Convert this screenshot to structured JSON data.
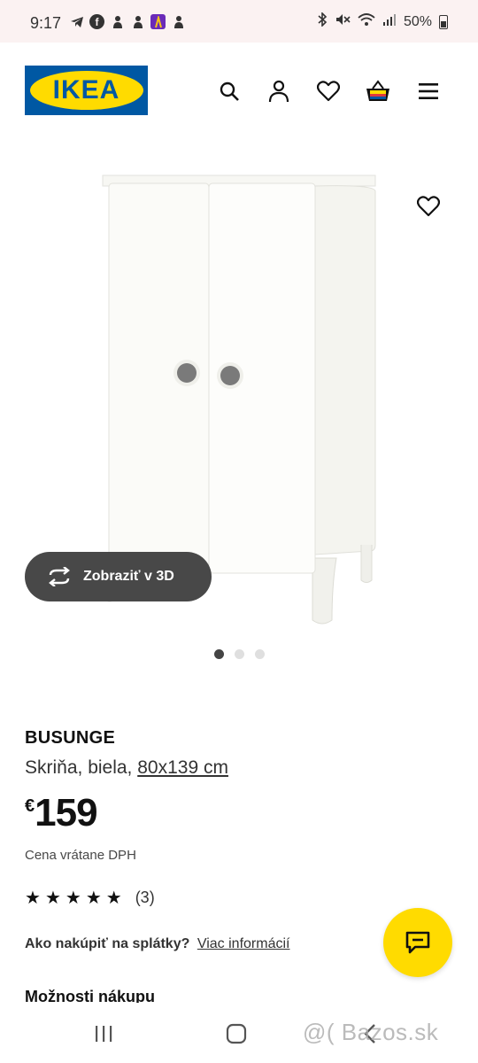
{
  "status_bar": {
    "time": "9:17",
    "battery": "50%",
    "left_icons": [
      "telegram-icon",
      "facebook-icon",
      "notification-icon",
      "notification-icon",
      "app-icon",
      "notification-icon"
    ],
    "right_icons": [
      "bluetooth-icon",
      "mute-icon",
      "wifi-icon",
      "signal-icon",
      "battery-icon"
    ]
  },
  "header": {
    "logo_text": "IKEA",
    "icons": [
      "search-icon",
      "account-icon",
      "heart-icon",
      "cart-icon",
      "menu-icon"
    ]
  },
  "gallery": {
    "view_3d_label": "Zobraziť v 3D",
    "dot_count": 3,
    "active_dot": 0
  },
  "product": {
    "name": "BUSUNGE",
    "desc_prefix": "Skriňa, biela, ",
    "measurement": "80x139 cm",
    "currency": "€",
    "price": "159",
    "price_note": "Cena vrátane DPH",
    "rating_stars": 5,
    "rating_count": "(3)",
    "installments_q": "Ako nakúpiť na splátky?",
    "installments_link": "Viac informácií",
    "purchase_options": "Možnosti nákupu"
  },
  "watermark": "@( Bazos.sk",
  "colors": {
    "ikea_blue": "#0058a3",
    "ikea_yellow": "#ffdb00",
    "dark_button": "#484848"
  }
}
